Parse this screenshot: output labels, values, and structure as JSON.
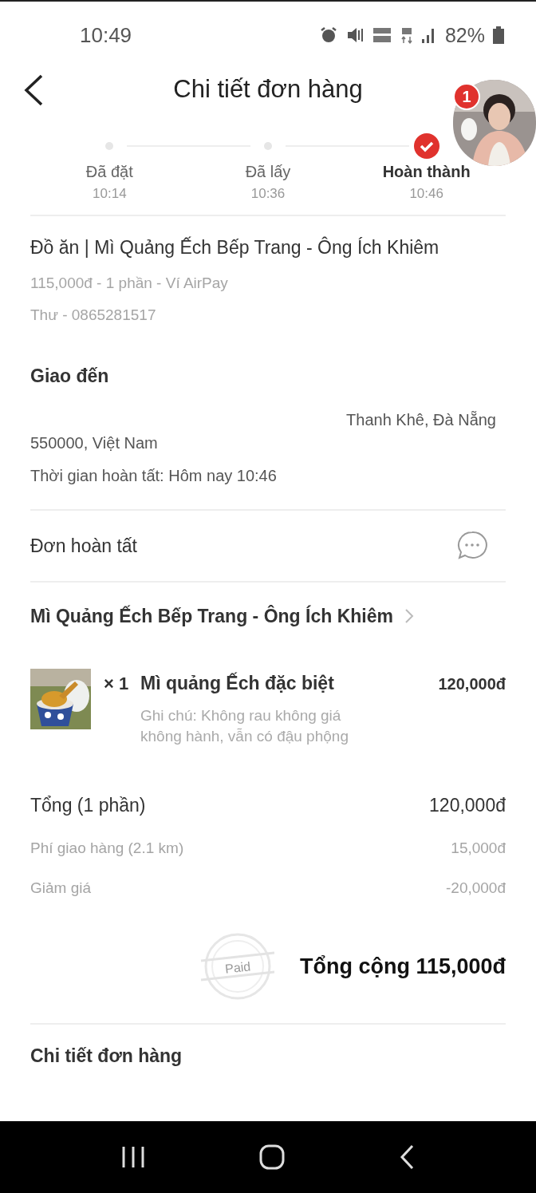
{
  "status_bar": {
    "time": "10:49",
    "battery": "82%"
  },
  "header": {
    "title": "Chi tiết đơn hàng",
    "chat_badge": "1"
  },
  "steps": [
    {
      "label": "Đã đặt",
      "time": "10:14",
      "current": false
    },
    {
      "label": "Đã lấy",
      "time": "10:36",
      "current": false
    },
    {
      "label": "Hoàn thành",
      "time": "10:46",
      "current": true
    }
  ],
  "order": {
    "title": "Đồ ăn | Mì Quảng Ếch Bếp Trang - Ông Ích Khiêm",
    "summary": "115,000đ - 1 phần - Ví AirPay",
    "contact": "Thư - 0865281517"
  },
  "delivery": {
    "heading": "Giao đến",
    "address_line_1": "Thanh Khê, Đà Nẵng",
    "address_line_2": "550000, Việt Nam",
    "completed": "Thời gian hoàn tất: Hôm nay 10:46"
  },
  "status": {
    "label": "Đơn hoàn tất"
  },
  "shop": {
    "name": "Mì Quảng Ếch Bếp Trang - Ông Ích Khiêm"
  },
  "items": [
    {
      "quantity": "× 1",
      "name": "Mì quảng Ếch đặc biệt",
      "price": "120,000đ",
      "note": "Ghi chú: Không rau không giá không hành, vẫn có đậu phộng"
    }
  ],
  "totals": [
    {
      "label": "Tổng (1 phần)",
      "value": "120,000đ",
      "kind": "subtotal"
    },
    {
      "label": "Phí giao hàng (2.1 km)",
      "value": "15,000đ",
      "kind": "fee"
    },
    {
      "label": "Giảm giá",
      "value": "-20,000đ",
      "kind": "fee"
    }
  ],
  "grand_total": {
    "stamp": "Paid",
    "label": "Tổng cộng 115,000đ"
  },
  "next_section": {
    "heading": "Chi tiết đơn hàng"
  }
}
